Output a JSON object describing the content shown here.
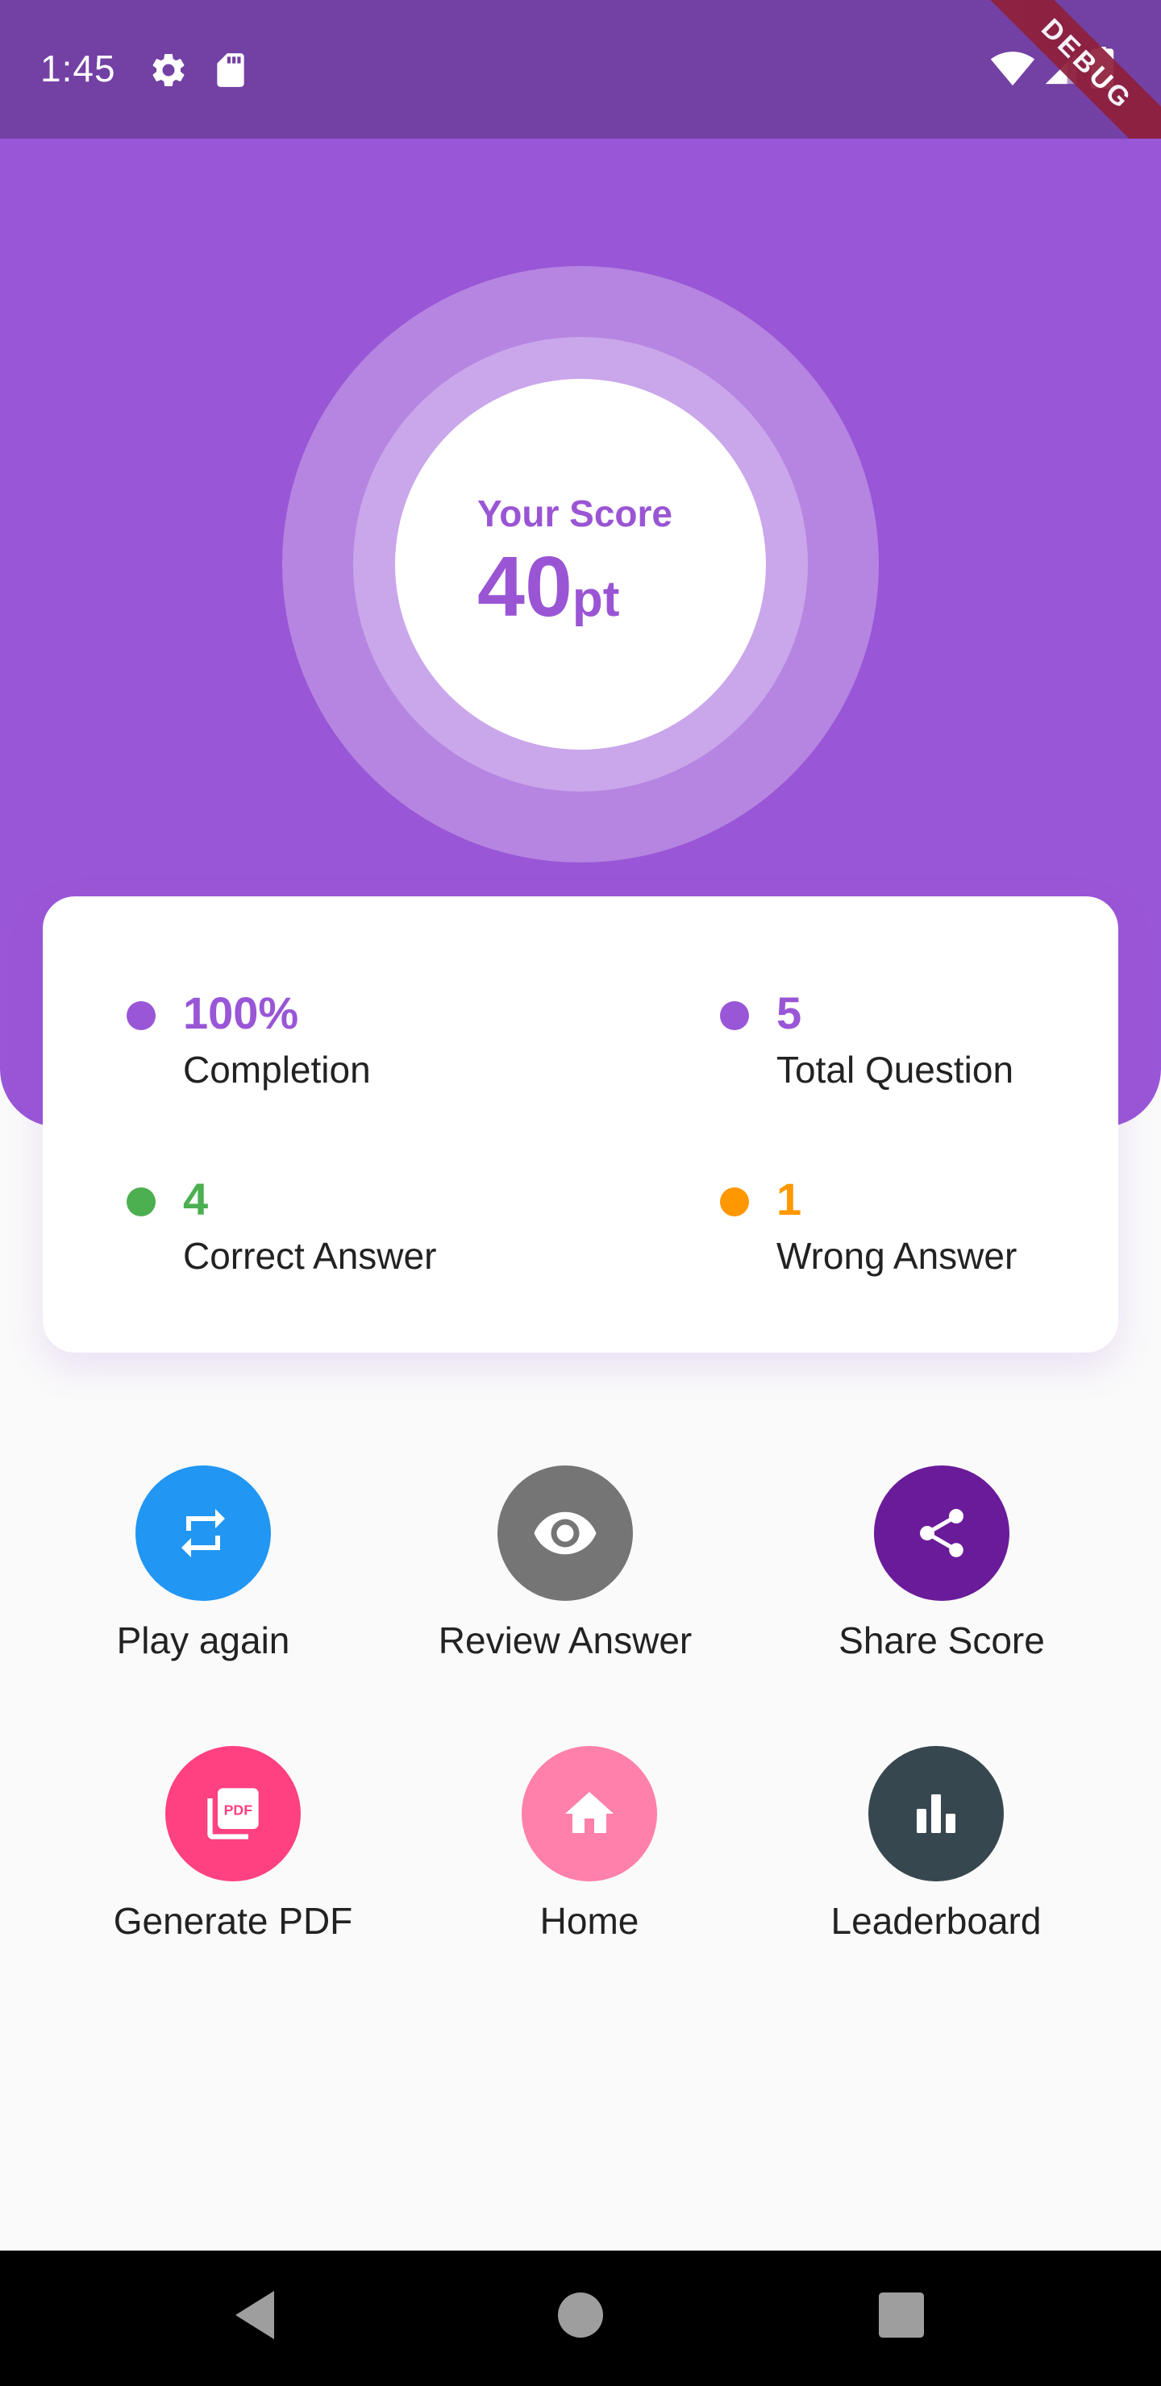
{
  "status_bar": {
    "time": "1:45",
    "icons": [
      "gear-icon",
      "sd-card-icon",
      "wifi-icon",
      "signal-icon",
      "battery-icon"
    ],
    "debug_label": "DEBUG"
  },
  "score": {
    "label": "Your Score",
    "value": "40",
    "unit": "pt"
  },
  "stats": {
    "completion": {
      "value": "100%",
      "label": "Completion",
      "color": "#9956d6"
    },
    "total_question": {
      "value": "5",
      "label": "Total Question",
      "color": "#9956d6"
    },
    "correct_answer": {
      "value": "4",
      "label": "Correct Answer",
      "color": "#4caf50"
    },
    "wrong_answer": {
      "value": "1",
      "label": "Wrong Answer",
      "color": "#ff9800"
    }
  },
  "actions": {
    "play_again": {
      "label": "Play again",
      "icon": "repeat-icon",
      "color": "#2196f3"
    },
    "review_answer": {
      "label": "Review Answer",
      "icon": "eye-icon",
      "color": "#757575"
    },
    "share_score": {
      "label": "Share Score",
      "icon": "share-icon",
      "color": "#6a1b9a"
    },
    "generate_pdf": {
      "label": "Generate PDF",
      "icon": "pdf-icon",
      "color": "#ff4081"
    },
    "home": {
      "label": "Home",
      "icon": "home-icon",
      "color": "#ff80ab"
    },
    "leaderboard": {
      "label": "Leaderboard",
      "icon": "bar-chart-icon",
      "color": "#37474f"
    }
  },
  "nav": {
    "icons": [
      "back-icon",
      "home-nav-icon",
      "recents-icon"
    ]
  },
  "colors": {
    "primary": "#9956d6",
    "status_bar": "#7340a3",
    "background": "#fafafa"
  }
}
